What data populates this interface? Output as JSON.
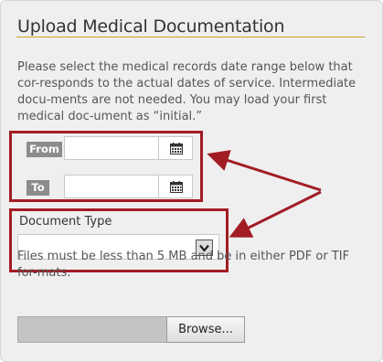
{
  "section": {
    "title": "Upload Medical Documentation",
    "intro": "Please select the medical records date range below that cor-responds to the actual dates of service. Intermediate docu-ments are not needed. You may load your first medical doc-ument as “initial.”"
  },
  "date_range": {
    "from_label": "From",
    "from_value": "",
    "to_label": "To",
    "to_value": ""
  },
  "document_type": {
    "label": "Document Type",
    "selected": ""
  },
  "upload": {
    "note": "Files must be less than 5 MB and be in either PDF or TIF for-mats.",
    "file_value": "",
    "browse_label": "Browse..."
  },
  "colors": {
    "highlight": "#a21d24",
    "title_rule": "#c9a227",
    "label_bg": "#8c8c8c"
  }
}
